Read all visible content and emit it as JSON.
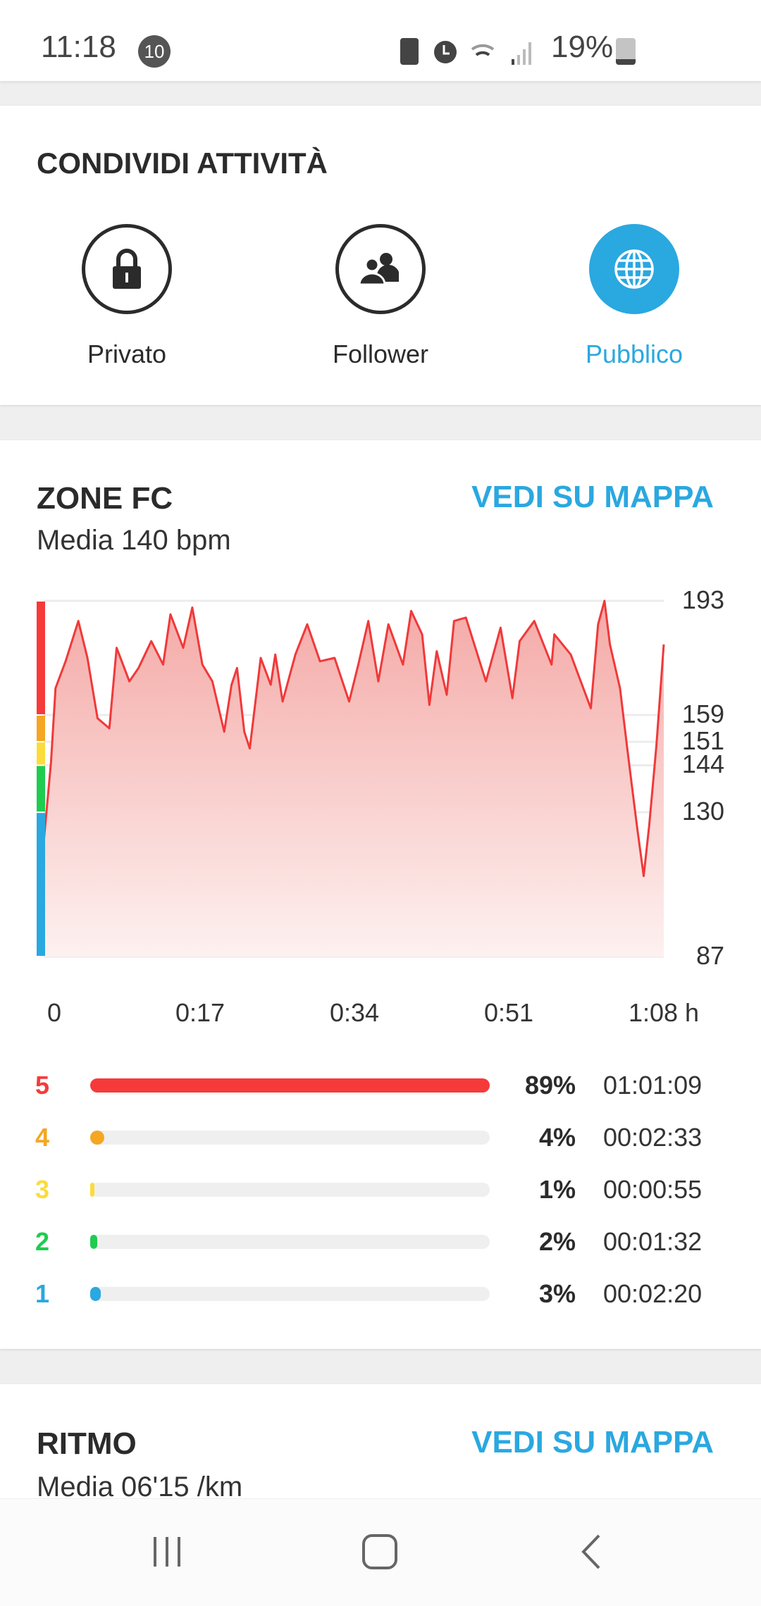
{
  "status_bar": {
    "time": "11:18",
    "notification_count": "10",
    "battery": "19%",
    "icons": [
      "battery-saver-icon",
      "alarm-icon",
      "wifi-icon",
      "signal-icon",
      "battery-icon"
    ]
  },
  "share": {
    "title": "CONDIVIDI ATTIVITÀ",
    "options": [
      {
        "label": "Privato",
        "icon": "lock-icon",
        "selected": false
      },
      {
        "label": "Follower",
        "icon": "people-icon",
        "selected": false
      },
      {
        "label": "Pubblico",
        "icon": "globe-icon",
        "selected": true
      }
    ]
  },
  "hr": {
    "title": "ZONE FC",
    "map_link": "VEDI SU MAPPA",
    "average": "Media 140 bpm",
    "zones": [
      {
        "zone": "5",
        "percent": "89%",
        "time": "01:01:09",
        "fraction": 0.89,
        "color": "#f63a3a"
      },
      {
        "zone": "4",
        "percent": "4%",
        "time": "00:02:33",
        "fraction": 0.04,
        "color": "#f5a623"
      },
      {
        "zone": "3",
        "percent": "1%",
        "time": "00:00:55",
        "fraction": 0.01,
        "color": "#fbdc3c"
      },
      {
        "zone": "2",
        "percent": "2%",
        "time": "00:01:32",
        "fraction": 0.02,
        "color": "#1ecc4f"
      },
      {
        "zone": "1",
        "percent": "3%",
        "time": "00:02:20",
        "fraction": 0.03,
        "color": "#2aa8e0"
      }
    ]
  },
  "chart_data": {
    "type": "area",
    "xlabel": "",
    "ylabel": "",
    "xlim": [
      0,
      68
    ],
    "ylim": [
      87,
      193
    ],
    "x_ticks": [
      "0",
      "0:17",
      "0:34",
      "0:51",
      "1:08 h"
    ],
    "x_tick_values": [
      0,
      17,
      34,
      51,
      68
    ],
    "y_ticks": [
      "193",
      "159",
      "151",
      "144",
      "130",
      "87"
    ],
    "y_tick_values": [
      193,
      159,
      151,
      144,
      130,
      87
    ],
    "zone_bands": [
      {
        "from": 159,
        "to": 193,
        "color": "#f63a3a"
      },
      {
        "from": 151,
        "to": 159,
        "color": "#f5a623"
      },
      {
        "from": 144,
        "to": 151,
        "color": "#fbdc3c"
      },
      {
        "from": 130,
        "to": 144,
        "color": "#1ecc4f"
      },
      {
        "from": 87,
        "to": 130,
        "color": "#2aa8e0"
      }
    ],
    "line_color": "#f0393a",
    "grid": true,
    "x": [
      0,
      0.8,
      1.3,
      2.4,
      3.8,
      4.8,
      5.9,
      7.2,
      8.0,
      9.4,
      10.4,
      11.8,
      13.1,
      13.9,
      15.3,
      16.3,
      17.4,
      18.5,
      19.8,
      20.6,
      21.2,
      22.0,
      22.6,
      23.8,
      24.9,
      25.4,
      26.2,
      27.6,
      28.9,
      30.3,
      31.9,
      33.5,
      34.5,
      35.6,
      36.7,
      37.8,
      39.4,
      40.3,
      41.5,
      42.3,
      43.1,
      44.2,
      45.0,
      46.3,
      48.5,
      50.1,
      51.4,
      52.2,
      53.8,
      55.7,
      56.0,
      57.8,
      58.9,
      60.0,
      60.8,
      61.5,
      62.1,
      63.2,
      64.0,
      64.5,
      65.1,
      65.8,
      66.4,
      67.2,
      68
    ],
    "y": [
      121,
      145,
      167,
      175,
      187,
      176,
      158,
      155,
      179,
      169,
      173,
      181,
      174,
      189,
      179,
      191,
      174,
      169,
      154,
      168,
      173,
      154,
      149,
      176,
      168,
      177,
      163,
      177,
      186,
      175,
      176,
      163,
      174,
      187,
      169,
      186,
      174,
      190,
      183,
      162,
      178,
      165,
      187,
      188,
      169,
      185,
      164,
      181,
      187,
      174,
      183,
      177,
      169,
      161,
      186,
      193,
      180,
      167,
      149,
      138,
      125,
      111,
      126,
      150,
      180
    ]
  },
  "pace": {
    "title": "RITMO",
    "map_link": "VEDI SU MAPPA",
    "average": "Media 06'15 /km"
  },
  "nav": {
    "icons": [
      "recent-apps-icon",
      "home-icon",
      "back-icon"
    ]
  }
}
